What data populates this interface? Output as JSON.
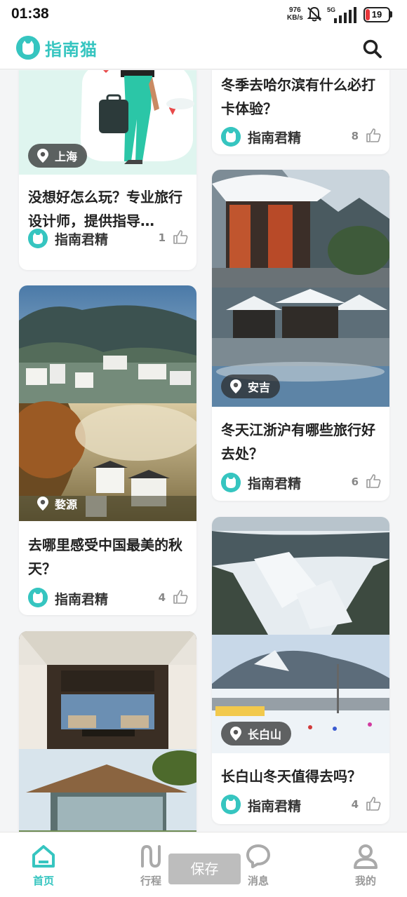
{
  "status_bar": {
    "time": "01:38",
    "net_speed": "976",
    "net_unit": "KB/s",
    "signal": "5G",
    "battery": "19"
  },
  "header": {
    "app_name": "指南猫"
  },
  "cards_left": [
    {
      "location": "上海",
      "title": "没想好怎么玩？专业旅行设计师，提供指导…",
      "author": "指南君精",
      "likes": "1"
    },
    {
      "location": "婺源",
      "title": "去哪里感受中国最美的秋天？",
      "author": "指南君精",
      "likes": "4"
    },
    {
      "location": "",
      "title": "",
      "author": "",
      "likes": ""
    }
  ],
  "cards_right": [
    {
      "location": "",
      "title": "冬季去哈尔滨有什么必打卡体验？",
      "author": "指南君精",
      "likes": "8"
    },
    {
      "location": "安吉",
      "title": "冬天江浙沪有哪些旅行好去处？",
      "author": "指南君精",
      "likes": "6"
    },
    {
      "location": "长白山",
      "title": "长白山冬天值得去吗？",
      "author": "指南君精",
      "likes": "4"
    }
  ],
  "nav": {
    "items": [
      {
        "label": "首页",
        "icon": "home-icon",
        "active": true
      },
      {
        "label": "行程",
        "icon": "itinerary-icon",
        "active": false
      },
      {
        "label": "消息",
        "icon": "message-icon",
        "active": false
      },
      {
        "label": "我的",
        "icon": "profile-icon",
        "active": false
      }
    ],
    "save_label": "保存"
  },
  "colors": {
    "accent": "#36c5c0",
    "nav_inactive": "#999999",
    "battery_low": "#e8363a"
  }
}
